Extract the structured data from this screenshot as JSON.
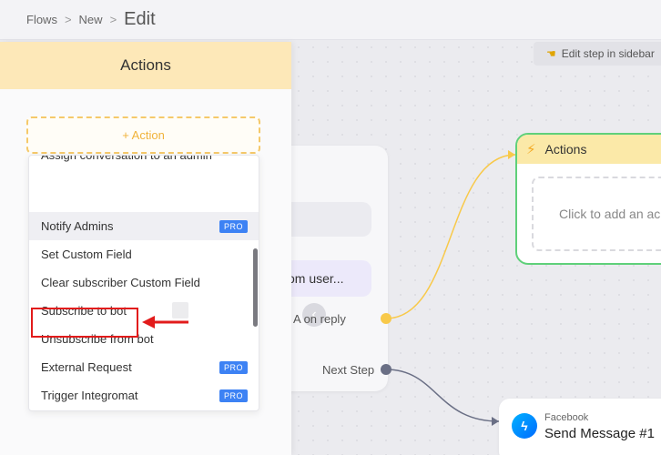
{
  "breadcrumb": {
    "items": [
      "Flows",
      "New"
    ],
    "separator": ">",
    "current": "Edit"
  },
  "canvas": {
    "hint": "Edit step in sidebar",
    "center_node": {
      "message_preview": "om user...",
      "collapse_glyph": "‹",
      "ports": {
        "action_on_reply": "A    on reply",
        "next_step": "Next Step"
      }
    },
    "actions_node": {
      "title": "Actions",
      "placeholder": "Click to add an ac"
    },
    "send_node": {
      "platform": "Facebook",
      "title": "Send Message #1"
    }
  },
  "sidebar": {
    "title": "Actions",
    "add_action_label": "+ Action",
    "dropdown_items": [
      {
        "label": "Assign conversation to an admin",
        "pro": false
      },
      {
        "label": "Notify Admins",
        "pro": true
      },
      {
        "label": "Set Custom Field",
        "pro": false
      },
      {
        "label": "Clear subscriber Custom Field",
        "pro": false
      },
      {
        "label": "Subscribe to bot",
        "pro": false
      },
      {
        "label": "Unsubscribe from bot",
        "pro": false
      },
      {
        "label": "External Request",
        "pro": true
      },
      {
        "label": "Trigger Integromat",
        "pro": true
      }
    ],
    "pro_badge": "PRO",
    "highlighted_item": "External Request"
  },
  "colors": {
    "accent_yellow": "#f5c96a",
    "port_yellow": "#f8c94a",
    "port_gray": "#6a6f85",
    "success_green": "#5fd07a",
    "pro_blue": "#3d82f4",
    "annotation_red": "#e21b1b"
  },
  "icons": {
    "hint": "pointing-hand-icon",
    "actions_node": "lightning-bolt-icon",
    "send_node": "messenger-icon"
  }
}
